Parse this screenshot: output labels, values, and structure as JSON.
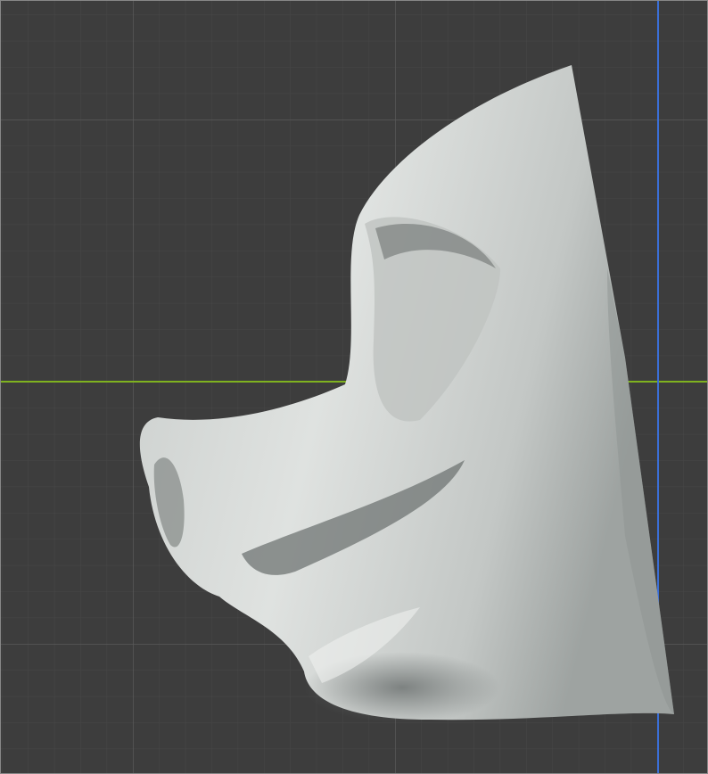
{
  "viewport": {
    "background_color": "#3d3d3d",
    "minor_grid_color": "#474747",
    "major_grid_color": "#595959",
    "x_axis_color": "#7fb21f",
    "y_axis_color": "#3b6fd6",
    "mesh_light_color": "#dfe2e0",
    "mesh_mid_color": "#a9aeac",
    "mesh_dark_color": "#5e6362"
  }
}
